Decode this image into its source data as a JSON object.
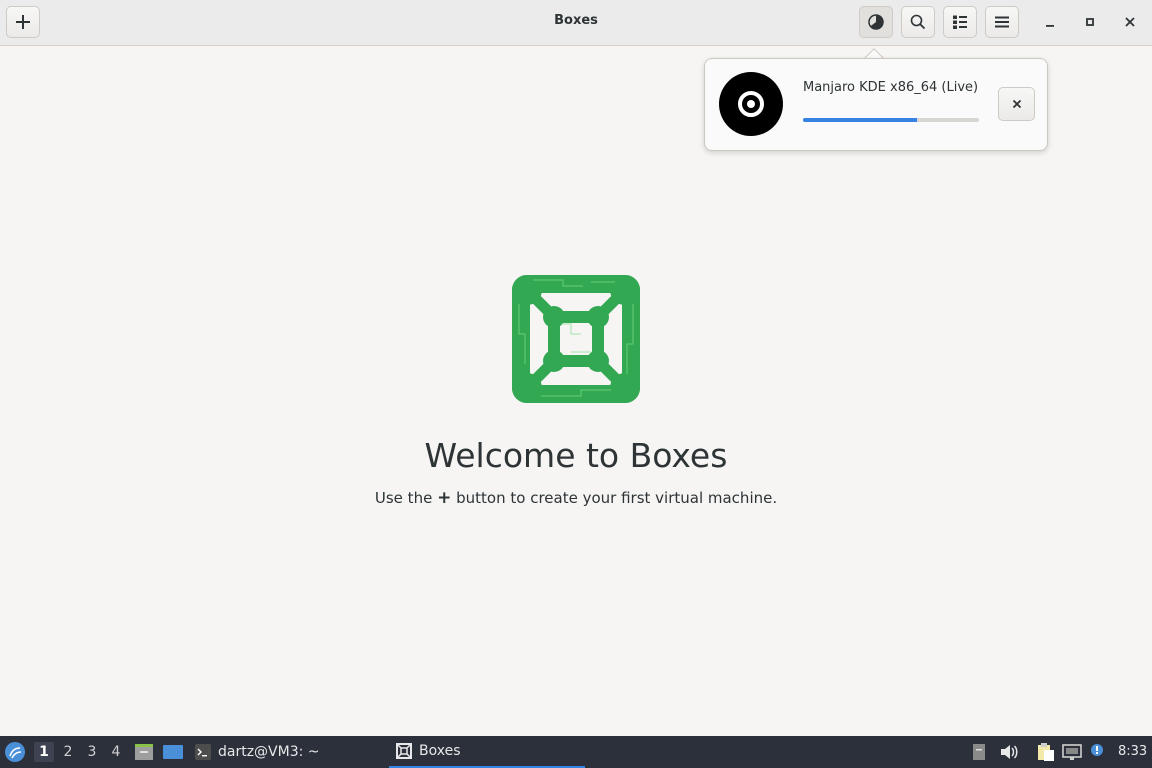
{
  "window": {
    "title": "Boxes",
    "new_button_icon": "plus-icon",
    "header_buttons": [
      "downloads-icon",
      "search-icon",
      "view-list-icon",
      "menu-icon"
    ],
    "controls": [
      "minimize-icon",
      "maximize-icon",
      "close-icon"
    ]
  },
  "popover": {
    "item_name": "Manjaro KDE x86_64 (Live)",
    "progress": 0.65,
    "icon": "disc-icon",
    "close_icon": "close-icon"
  },
  "welcome": {
    "title": "Welcome to Boxes",
    "subtitle_before": "Use the",
    "subtitle_plus": "+",
    "subtitle_after": "button to create your first virtual machine."
  },
  "taskbar": {
    "workspaces": [
      "1",
      "2",
      "3",
      "4"
    ],
    "current_workspace": "1",
    "tasks": [
      {
        "label": "dartz@VM3: ~",
        "icon": "terminal-icon"
      },
      {
        "label": "Boxes",
        "icon": "boxes-icon"
      }
    ],
    "clock": "8:33"
  },
  "colors": {
    "accent": "#3584e4",
    "logo_green": "#33a852",
    "taskbar_bg": "#2b303b"
  }
}
